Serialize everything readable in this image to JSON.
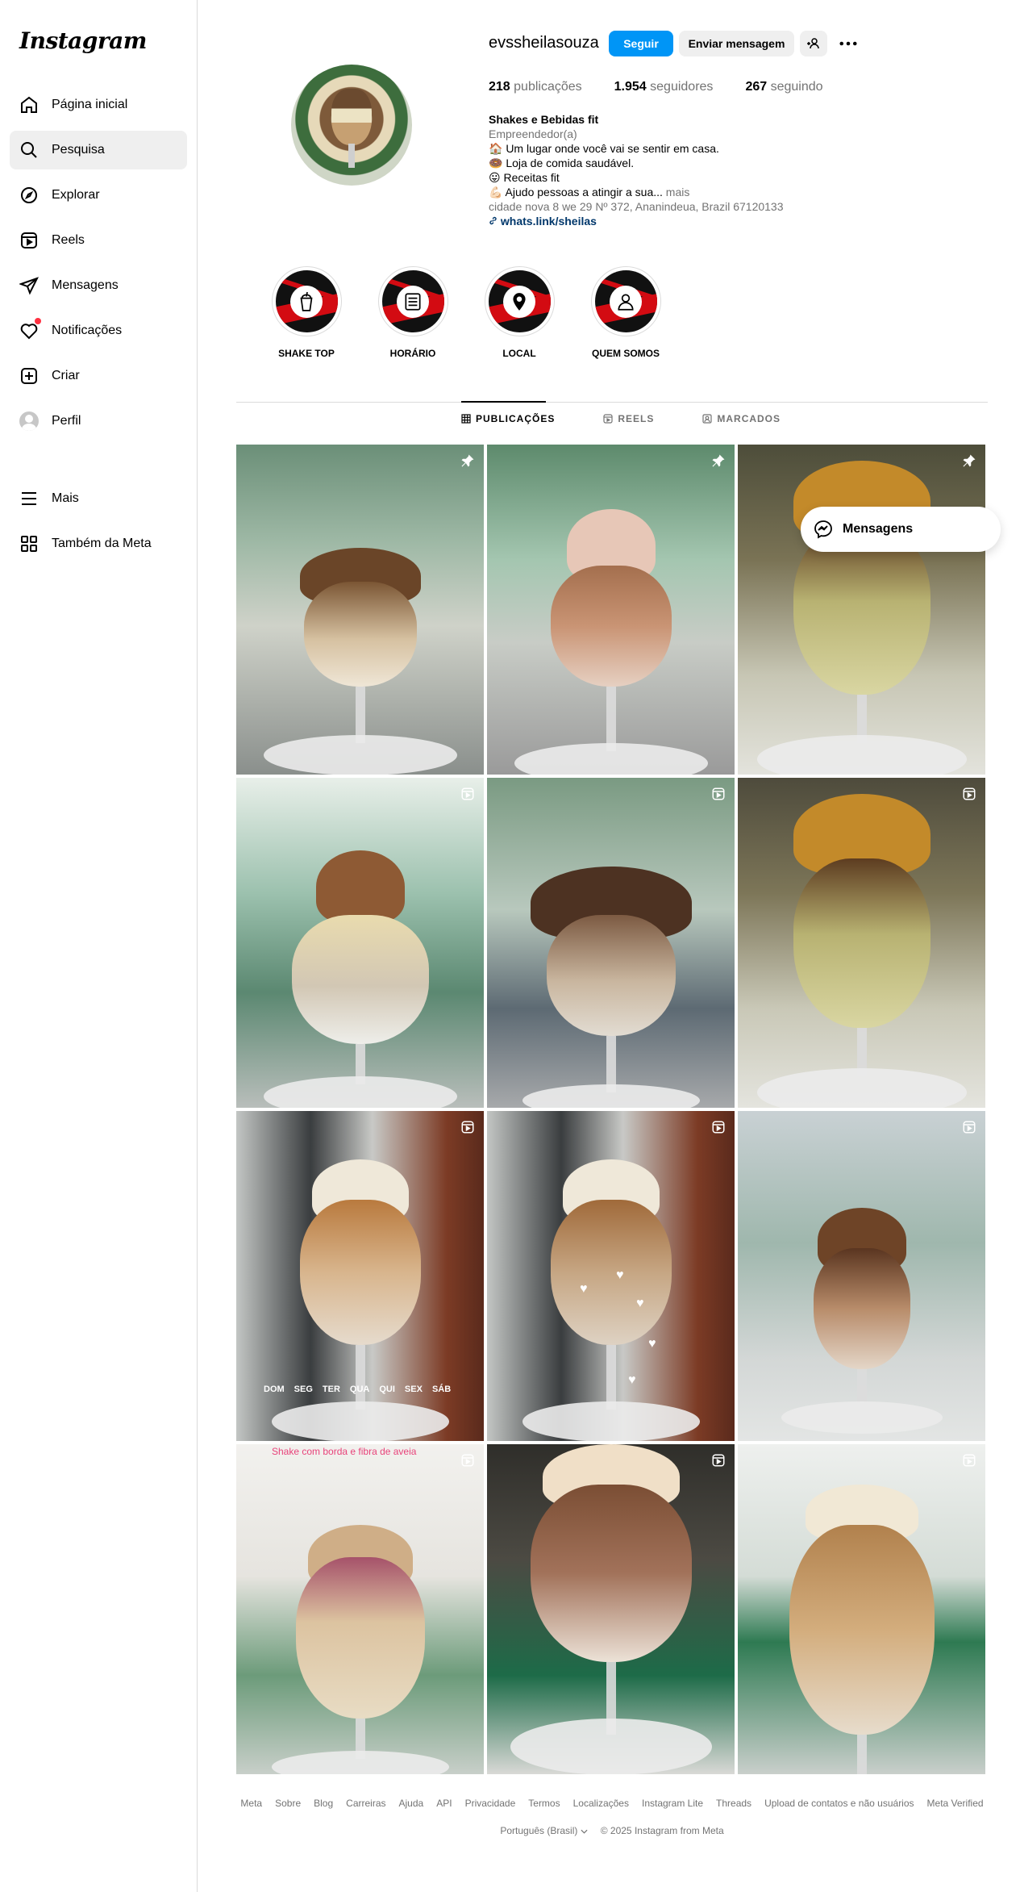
{
  "app": {
    "logo": "Instagram"
  },
  "sidebar": {
    "items": [
      {
        "label": "Página inicial",
        "icon": "home-icon"
      },
      {
        "label": "Pesquisa",
        "icon": "search-icon"
      },
      {
        "label": "Explorar",
        "icon": "compass-icon"
      },
      {
        "label": "Reels",
        "icon": "reels-icon"
      },
      {
        "label": "Mensagens",
        "icon": "paper-plane-icon"
      },
      {
        "label": "Notificações",
        "icon": "heart-icon"
      },
      {
        "label": "Criar",
        "icon": "plus-square-icon"
      },
      {
        "label": "Perfil",
        "icon": "avatar-icon"
      }
    ],
    "more_label": "Mais",
    "meta_label": "Também da Meta"
  },
  "profile": {
    "username": "evssheilasouza",
    "follow_label": "Seguir",
    "message_label": "Enviar mensagem",
    "stats": {
      "posts_count": "218",
      "posts_label": "publicações",
      "followers_count": "1.954",
      "followers_label": "seguidores",
      "following_count": "267",
      "following_label": "seguindo"
    },
    "bio": {
      "name": "Shakes e Bebidas fit",
      "category": "Empreendedor(a)",
      "lines": [
        "🏠 Um lugar onde você vai se sentir em casa.",
        "🍩 Loja de comida saudável.",
        "😛 Receitas fit",
        "💪🏻 Ajudo pessoas a atingir a sua..."
      ],
      "more": " mais",
      "address": "cidade nova 8 we 29 Nº 372, Ananindeua, Brazil 67120133",
      "link": "whats.link/sheilas"
    }
  },
  "highlights": [
    {
      "label": "SHAKE TOP",
      "icon": "shake-cup-icon"
    },
    {
      "label": "HORÁRIO",
      "icon": "schedule-icon"
    },
    {
      "label": "LOCAL",
      "icon": "location-pin-icon"
    },
    {
      "label": "QUEM SOMOS",
      "icon": "person-icon"
    }
  ],
  "tabs": [
    {
      "label": "PUBLICAÇÕES",
      "icon": "grid-icon",
      "active": true
    },
    {
      "label": "REELS",
      "icon": "reels-small-icon",
      "active": false
    },
    {
      "label": "MARCADOS",
      "icon": "tagged-icon",
      "active": false
    }
  ],
  "posts": [
    {
      "type": "pinned"
    },
    {
      "type": "pinned"
    },
    {
      "type": "pinned"
    },
    {
      "type": "reel"
    },
    {
      "type": "reel"
    },
    {
      "type": "reel"
    },
    {
      "type": "reel",
      "days": [
        "DOM",
        "SEG",
        "TER",
        "QUA",
        "QUI",
        "SEX",
        "SÁB"
      ]
    },
    {
      "type": "reel"
    },
    {
      "type": "reel"
    },
    {
      "type": "reel",
      "caption": "Shake com borda e fibra de aveia"
    },
    {
      "type": "reel"
    },
    {
      "type": "reel"
    }
  ],
  "floating_messages": {
    "label": "Mensagens"
  },
  "footer": {
    "links": [
      "Meta",
      "Sobre",
      "Blog",
      "Carreiras",
      "Ajuda",
      "API",
      "Privacidade",
      "Termos",
      "Localizações",
      "Instagram Lite",
      "Threads",
      "Upload de contatos e não usuários",
      "Meta Verified"
    ],
    "language": "Português (Brasil)",
    "copyright": "© 2025 Instagram from Meta"
  }
}
